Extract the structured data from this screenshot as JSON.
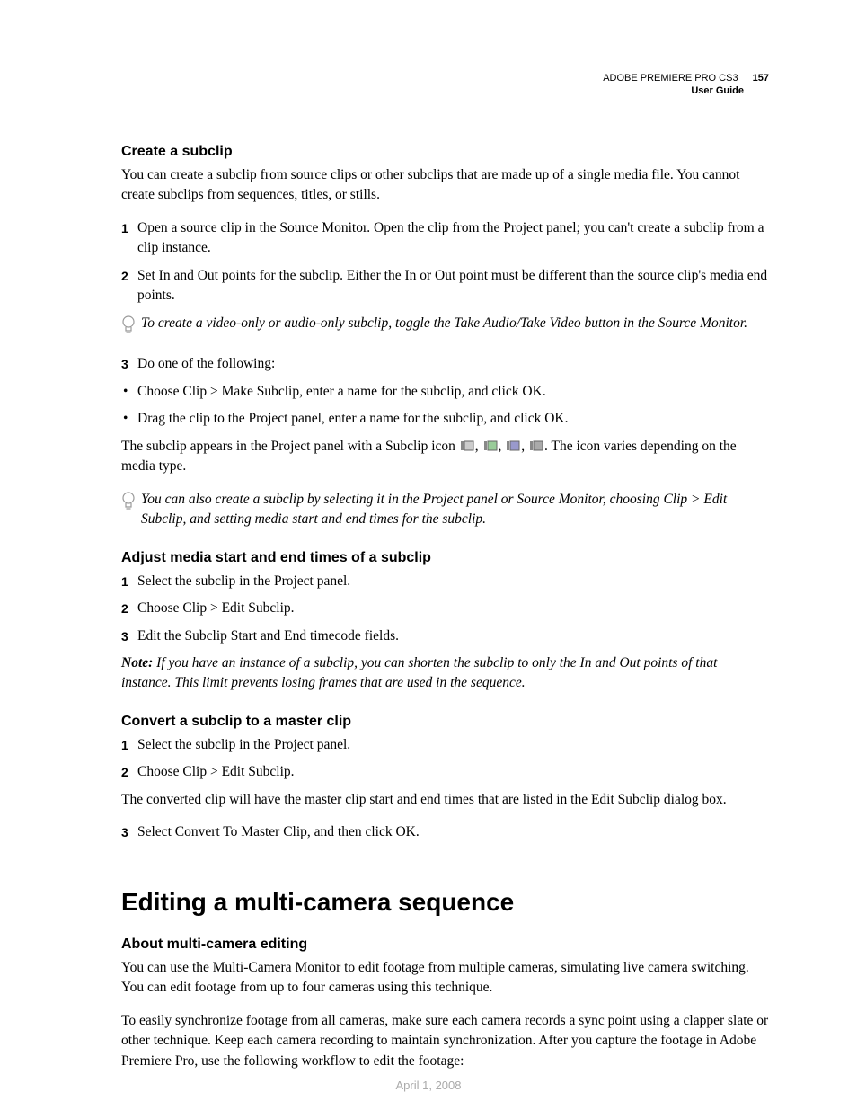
{
  "header": {
    "product": "ADOBE PREMIERE PRO CS3",
    "guide": "User Guide",
    "page_number": "157"
  },
  "s1": {
    "h": "Create a subclip",
    "p1": "You can create a subclip from source clips or other subclips that are made up of a single media file. You cannot create subclips from sequences, titles, or stills.",
    "step1": "Open a source clip in the Source Monitor. Open the clip from the Project panel; you can't create a subclip from a clip instance.",
    "step2": "Set In and Out points for the subclip. Either the In or Out point must be different than the source clip's media end points.",
    "tip1": "To create a video-only or audio-only subclip, toggle the Take Audio/Take Video button in the Source Monitor.",
    "step3": "Do one of the following:",
    "b1": "Choose Clip > Make Subclip, enter a name for the subclip, and click OK.",
    "b2": "Drag the clip to the Project panel, enter a name for the subclip, and click OK.",
    "p2a": "The subclip appears in the Project panel with a Subclip icon ",
    "p2b": ". The icon varies depending on the media type.",
    "tip2": "You can also create a subclip by selecting it in the Project panel or Source Monitor, choosing Clip > Edit Subclip, and setting media start and end times for the subclip."
  },
  "s2": {
    "h": "Adjust media start and end times of a subclip",
    "step1": "Select the subclip in the Project panel.",
    "step2": "Choose Clip > Edit Subclip.",
    "step3": "Edit the Subclip Start and End timecode fields.",
    "note_label": "Note:",
    "note": " If you have an instance of a subclip, you can shorten the subclip to only the In and Out points of that instance. This limit prevents losing frames that are used in the sequence."
  },
  "s3": {
    "h": "Convert a subclip to a master clip",
    "step1": "Select the subclip in the Project panel.",
    "step2": "Choose Clip > Edit Subclip.",
    "p1": "The converted clip will have the master clip start and end times that are listed in the Edit Subclip dialog box.",
    "step3": "Select Convert To Master Clip, and then click OK."
  },
  "s4": {
    "section": "Editing a multi-camera sequence",
    "h": "About multi-camera editing",
    "p1": "You can use the Multi-Camera Monitor to edit footage from multiple cameras, simulating live camera switching. You can edit footage from up to four cameras using this technique.",
    "p2": "To easily synchronize footage from all cameras, make sure each camera records a sync point using a clapper slate or other technique. Keep each camera recording to maintain synchronization. After you capture the footage in Adobe Premiere Pro, use the following workflow to edit the footage:"
  },
  "footer_date": "April 1, 2008"
}
